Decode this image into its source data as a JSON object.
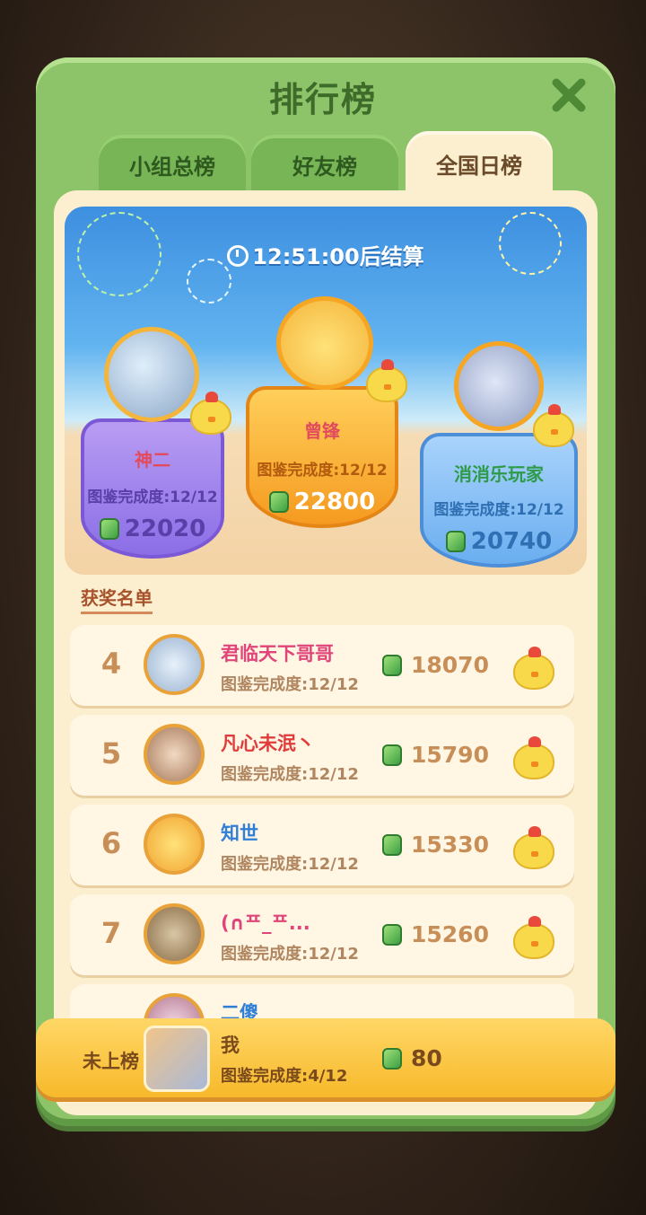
{
  "panel": {
    "title": "排行榜",
    "close_icon": "close-icon"
  },
  "tabs": [
    {
      "label": "小组总榜",
      "active": false
    },
    {
      "label": "好友榜",
      "active": false
    },
    {
      "label": "全国日榜",
      "active": true
    }
  ],
  "timer": {
    "text": "12:51:00后结算"
  },
  "podium": [
    {
      "rank": 1,
      "name": "曾锋",
      "completion": "图鉴完成度:12/12",
      "score": "22800"
    },
    {
      "rank": 2,
      "name": "神二",
      "completion": "图鉴完成度:12/12",
      "score": "22020"
    },
    {
      "rank": 3,
      "name": "消消乐玩家",
      "completion": "图鉴完成度:12/12",
      "score": "20740"
    }
  ],
  "award_list_label": "获奖名单",
  "rows": [
    {
      "rank": "4",
      "name": "君临天下哥哥",
      "completion": "图鉴完成度:12/12",
      "score": "18070"
    },
    {
      "rank": "5",
      "name": "凡心未泯丶",
      "completion": "图鉴完成度:12/12",
      "score": "15790"
    },
    {
      "rank": "6",
      "name": "知世",
      "completion": "图鉴完成度:12/12",
      "score": "15330"
    },
    {
      "rank": "7",
      "name": "(∩ᄑ_ᄑ...",
      "completion": "图鉴完成度:12/12",
      "score": "15260"
    },
    {
      "rank": "",
      "name": "二傻",
      "completion": "",
      "score": ""
    }
  ],
  "me": {
    "label": "未上榜",
    "name": "我",
    "completion": "图鉴完成度:4/12",
    "score": "80"
  },
  "colors": {
    "panel_green": "#8dc46a",
    "tab_active": "#fbefcf",
    "gold": "#f7b92b",
    "rank_text": "#c88e58"
  }
}
